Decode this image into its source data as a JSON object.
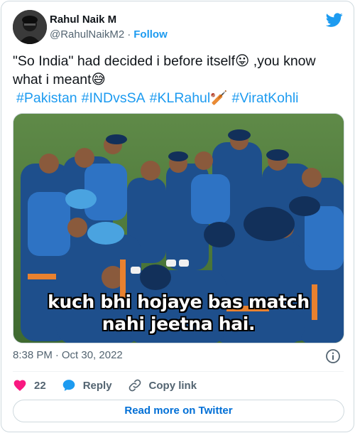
{
  "author": {
    "name": "Rahul Naik M",
    "handle": "@RahulNaikM2",
    "separator": "·",
    "follow_label": "Follow"
  },
  "tweet": {
    "text_line1": "\"So India\" had  decided i before itself😛 ,you know",
    "text_line2": "what i meant😅",
    "hashtags": [
      "#Pakistan",
      "#INDvsSA",
      "#KLRahul🏏",
      "#ViratKohli"
    ]
  },
  "media": {
    "caption_line1": "kuch bhi hojaye bas match",
    "caption_line2": "nahi jeetna hai."
  },
  "meta": {
    "time": "8:38 PM",
    "separator": "·",
    "date": "Oct 30, 2022"
  },
  "actions": {
    "like_count": "22",
    "reply_label": "Reply",
    "copy_label": "Copy link"
  },
  "read_more_label": "Read more on Twitter",
  "colors": {
    "accent": "#1d9bf0",
    "like": "#f91880",
    "link_button": "#006fd6",
    "muted": "#536471"
  }
}
